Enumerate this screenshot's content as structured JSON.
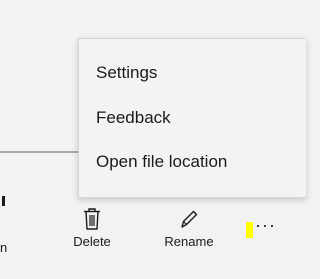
{
  "context_menu": {
    "items": [
      {
        "label": "Settings"
      },
      {
        "label": "Feedback"
      },
      {
        "label": "Open file location"
      }
    ]
  },
  "toolbar": {
    "delete_label": "Delete",
    "rename_label": "Rename",
    "more_label": "···",
    "edge_label": "n"
  },
  "colors": {
    "more_highlight": "#ffff00"
  },
  "icons": {
    "delete": "trash-icon",
    "rename": "pencil-icon",
    "more": "more-icon"
  }
}
